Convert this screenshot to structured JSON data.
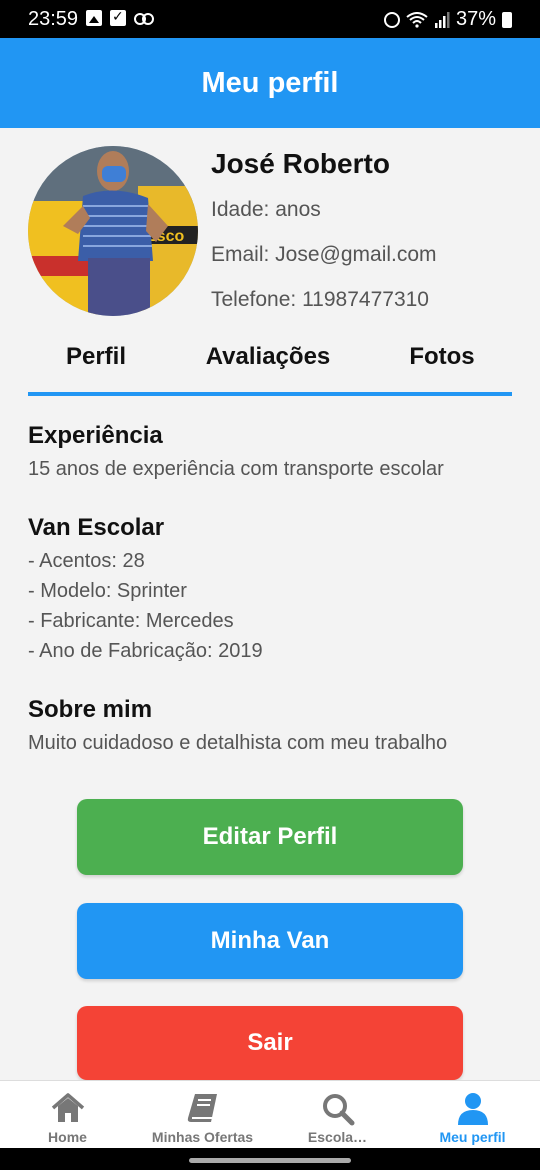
{
  "status_bar": {
    "time": "23:59",
    "battery": "37%"
  },
  "header": {
    "title": "Meu perfil"
  },
  "profile": {
    "name": "José Roberto",
    "age_line": "Idade:  anos",
    "email_line": "Email: Jose@gmail.com",
    "phone_line": "Telefone: 11987477310"
  },
  "tabs": [
    {
      "label": "Perfil"
    },
    {
      "label": "Avaliações"
    },
    {
      "label": "Fotos"
    }
  ],
  "sections": {
    "experience": {
      "title": "Experiência",
      "text": "15 anos de experiência com transporte escolar"
    },
    "van": {
      "title": "Van Escolar",
      "lines": [
        "- Acentos: 28",
        "- Modelo: Sprinter",
        "- Fabricante: Mercedes",
        "- Ano de Fabricação: 2019"
      ]
    },
    "about": {
      "title": "Sobre mim",
      "text": "Muito cuidadoso e detalhista com meu trabalho"
    }
  },
  "buttons": {
    "edit": "Editar Perfil",
    "van": "Minha Van",
    "logout": "Sair"
  },
  "bottom_nav": [
    {
      "label": "Home",
      "icon": "home-icon"
    },
    {
      "label": "Minhas Ofertas",
      "icon": "book-icon"
    },
    {
      "label": "Escola…",
      "icon": "search-icon"
    },
    {
      "label": "Meu perfil",
      "icon": "user-icon",
      "active": true
    }
  ],
  "colors": {
    "primary": "#2196F3",
    "edit_button": "#4CAF50",
    "logout_button": "#F44336",
    "inactive_nav": "#777777"
  }
}
